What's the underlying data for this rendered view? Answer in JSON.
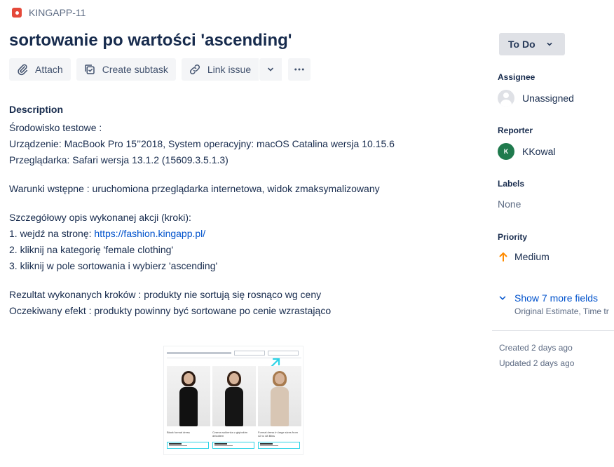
{
  "issue": {
    "key": "KINGAPP-11",
    "title": "sortowanie po wartości 'ascending'"
  },
  "toolbar": {
    "attach_label": "Attach",
    "subtask_label": "Create subtask",
    "link_label": "Link issue"
  },
  "description": {
    "heading": "Description",
    "lines": [
      "Środowisko testowe :",
      "Urządzenie: MacBook Pro 15’’2018, System operacyjny: macOS Catalina wersja 10.15.6",
      "Przeglądarka: Safari wersja 13.1.2 (15609.3.5.1.3)",
      "",
      "Warunki wstępne : uruchomiona przeglądarka internetowa, widok zmaksymalizowany",
      "",
      "Szczegółowy opis wykonanej akcji (kroki):",
      "1. wejdź na stronę: ",
      "2. kliknij na kategorię 'female clothing'",
      "3. kliknij w pole sortowania i wybierz 'ascending'",
      "",
      "Rezultat wykonanych kroków : produkty nie sortują się rosnąco wg ceny",
      "Oczekiwany efekt : produkty powinny być sortowane po cenie wzrastająco"
    ],
    "link_url": "https://fashion.kingapp.pl/"
  },
  "attachment": {
    "products": [
      "Black formal dress",
      "Czarna sukienka z głębokim dekoltem",
      "Formal dress in large sizes from 42 to 48 Bliss"
    ]
  },
  "sidebar": {
    "status": "To Do",
    "assignee_label": "Assignee",
    "assignee_value": "Unassigned",
    "reporter_label": "Reporter",
    "reporter_initial": "K",
    "reporter_value": "KKowal",
    "labels_label": "Labels",
    "labels_value": "None",
    "priority_label": "Priority",
    "priority_value": "Medium",
    "more_fields": "Show 7 more fields",
    "more_fields_sub": "Original Estimate, Time tr",
    "created": "Created 2 days ago",
    "updated": "Updated 2 days ago"
  },
  "colors": {
    "accent": "#0052cc",
    "priority_medium": "#ff8b00",
    "bug": "#e5493a",
    "reporter_avatar": "#1f7a4d"
  },
  "icons": [
    "bug-icon",
    "paperclip-icon",
    "subtask-icon",
    "link-icon",
    "chevron-down-icon",
    "more-icon",
    "user-icon",
    "priority-medium-icon"
  ]
}
